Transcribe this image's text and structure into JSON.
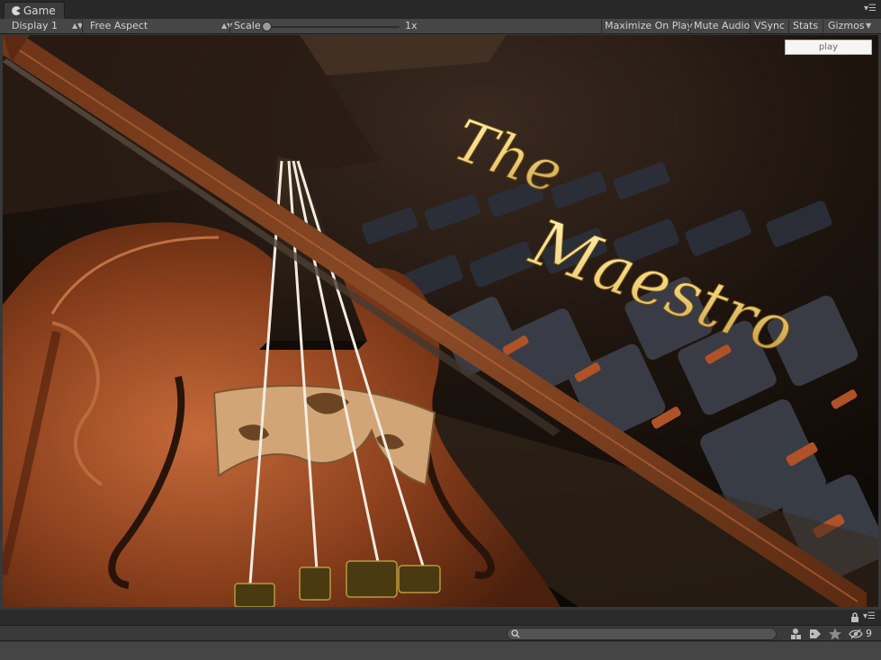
{
  "window": {
    "tab_label": "Game",
    "tab_icon": "pacman-game-icon"
  },
  "toolbar": {
    "display": "Display 1",
    "aspect": "Free Aspect",
    "scale_label": "Scale",
    "scale_value": "1x",
    "scale_fraction": 0,
    "buttons": [
      "Maximize On Play",
      "Mute Audio",
      "VSync",
      "Stats",
      "Gizmos"
    ]
  },
  "viewport": {
    "play_label": "play",
    "title_line1": "The",
    "title_line2": "Maestro"
  },
  "bottom": {
    "hidden_count": "9"
  },
  "colors": {
    "panel_dark": "#282828",
    "toolbar": "#464646",
    "wood": "#8a3f1c",
    "gold_title": "#f1d27a",
    "seat": "#404550"
  }
}
